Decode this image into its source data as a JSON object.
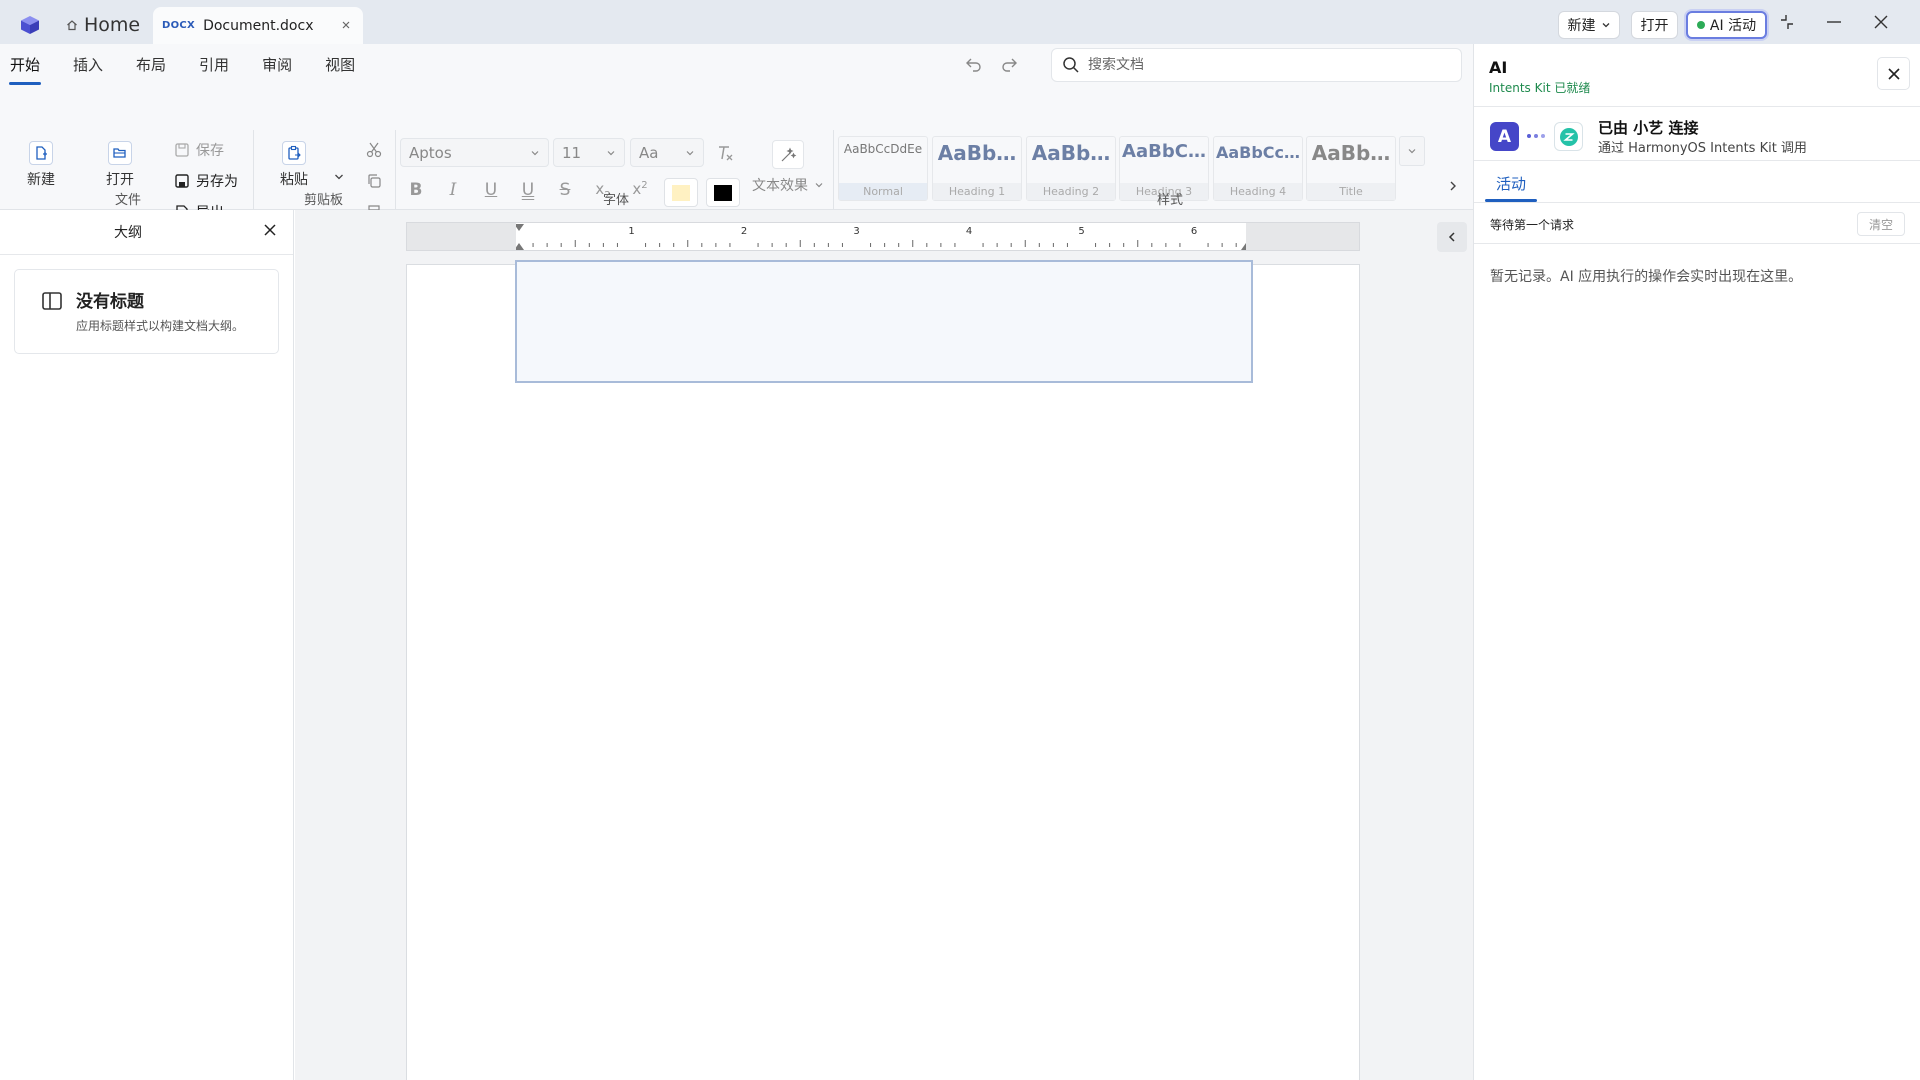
{
  "titlebar": {
    "home_label": "Home",
    "doc_tab": {
      "badge": "DOCX",
      "name": "Document.docx"
    },
    "new_button": "新建",
    "open_button": "打开",
    "ai_button": "AI 活动",
    "ai_status_color": "#2dab57"
  },
  "ribbon": {
    "tabs": [
      "开始",
      "插入",
      "布局",
      "引用",
      "审阅",
      "视图"
    ],
    "active_tab": "开始",
    "search_placeholder": "搜索文档",
    "file_group": {
      "label": "文件",
      "new": "新建",
      "open": "打开",
      "save": "保存",
      "save_as": "另存为",
      "export": "导出"
    },
    "clipboard_group": {
      "label": "剪贴板",
      "paste": "粘贴"
    },
    "font_group": {
      "label": "字体",
      "font_name": "Aptos",
      "font_size": "11",
      "case": "Aa",
      "text_effects": "文本效果",
      "highlight_color": "#fff1c2",
      "font_color": "#000000"
    },
    "styles_group": {
      "label": "样式",
      "items": [
        {
          "sample": "AaBbCcDdEe",
          "name": "Normal"
        },
        {
          "sample": "AaBb…",
          "name": "Heading 1"
        },
        {
          "sample": "AaBb…",
          "name": "Heading 2"
        },
        {
          "sample": "AaBbC…",
          "name": "Heading 3"
        },
        {
          "sample": "AaBbCc…",
          "name": "Heading 4"
        },
        {
          "sample": "AaBb…",
          "name": "Title"
        }
      ]
    }
  },
  "outline": {
    "title": "大纲",
    "empty_heading": "没有标题",
    "empty_hint": "应用标题样式以构建文档大纲。"
  },
  "ruler": {
    "labels": [
      "1",
      "2",
      "3",
      "4",
      "5",
      "6"
    ]
  },
  "ai_panel": {
    "title": "AI",
    "status": "Intents Kit 已就绪",
    "avatar_letter": "A",
    "connection_title": "已由 小艺 连接",
    "connection_subtitle": "通过 HarmonyOS Intents Kit 调用",
    "tab": "活动",
    "waiting": "等待第一个请求",
    "clear_button": "清空",
    "empty_message": "暂无记录。AI 应用执行的操作会实时出现在这里。"
  }
}
